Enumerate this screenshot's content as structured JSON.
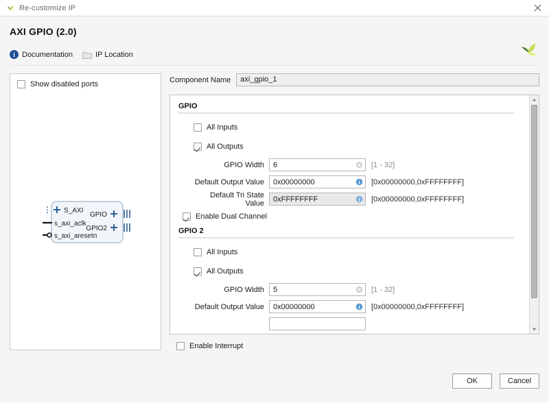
{
  "titlebar": {
    "text": "Re-customize IP",
    "logo_icon": "xilinx-logo-icon",
    "close_icon": "close-icon"
  },
  "header": {
    "ip_title": "AXI GPIO (2.0)",
    "brand_logo_icon": "xilinx-logo-icon",
    "links": [
      {
        "label": "Documentation",
        "icon": "info-icon"
      },
      {
        "label": "IP Location",
        "icon": "folder-icon"
      }
    ]
  },
  "preview": {
    "show_disabled_ports": {
      "label": "Show disabled ports",
      "checked": false
    },
    "block": {
      "left_ports": [
        {
          "label": "S_AXI",
          "type": "bus"
        },
        {
          "label": "s_axi_aclk",
          "type": "clock"
        },
        {
          "label": "s_axi_aresetn",
          "type": "reset"
        }
      ],
      "right_ports": [
        {
          "label": "GPIO",
          "type": "bus"
        },
        {
          "label": "GPIO2",
          "type": "bus"
        }
      ]
    }
  },
  "component_name": {
    "label": "Component Name",
    "value": "axi_gpio_1"
  },
  "sections": [
    {
      "title": "GPIO",
      "checkboxes": [
        {
          "label": "All Inputs",
          "checked": false
        },
        {
          "label": "All Outputs",
          "checked": true
        }
      ],
      "fields": [
        {
          "label": "GPIO Width",
          "value": "6",
          "hint": "[1 - 32]",
          "hint_style": "muted",
          "icon": "clear-icon",
          "disabled": false
        },
        {
          "label": "Default Output Value",
          "value": "0x00000000",
          "hint": "[0x00000000,0xFFFFFFFF]",
          "hint_style": "dark",
          "icon": "info-icon",
          "disabled": false
        },
        {
          "label": "Default Tri State Value",
          "value": "0xFFFFFFFF",
          "hint": "[0x00000000,0xFFFFFFFF]",
          "hint_style": "dark",
          "icon": "info-icon",
          "disabled": true
        }
      ]
    },
    {
      "title": "GPIO 2",
      "checkboxes": [
        {
          "label": "All Inputs",
          "checked": false
        },
        {
          "label": "All Outputs",
          "checked": true
        }
      ],
      "fields": [
        {
          "label": "GPIO Width",
          "value": "5",
          "hint": "[1 - 32]",
          "hint_style": "muted",
          "icon": "clear-icon",
          "disabled": false
        },
        {
          "label": "Default Output Value",
          "value": "0x00000000",
          "hint": "[0x00000000,0xFFFFFFFF]",
          "hint_style": "dark",
          "icon": "info-icon",
          "disabled": false
        }
      ]
    }
  ],
  "enable_dual_channel": {
    "label": "Enable Dual Channel",
    "checked": true
  },
  "enable_interrupt": {
    "label": "Enable Interrupt",
    "checked": false
  },
  "footer": {
    "ok_label": "OK",
    "cancel_label": "Cancel"
  },
  "colors": {
    "accent_blue": "#1f4e96",
    "port_blue": "#2a5d96",
    "block_fill": "#f2f6fb",
    "logo_green": "#9fc63b",
    "logo_dark_green": "#5c8727"
  }
}
